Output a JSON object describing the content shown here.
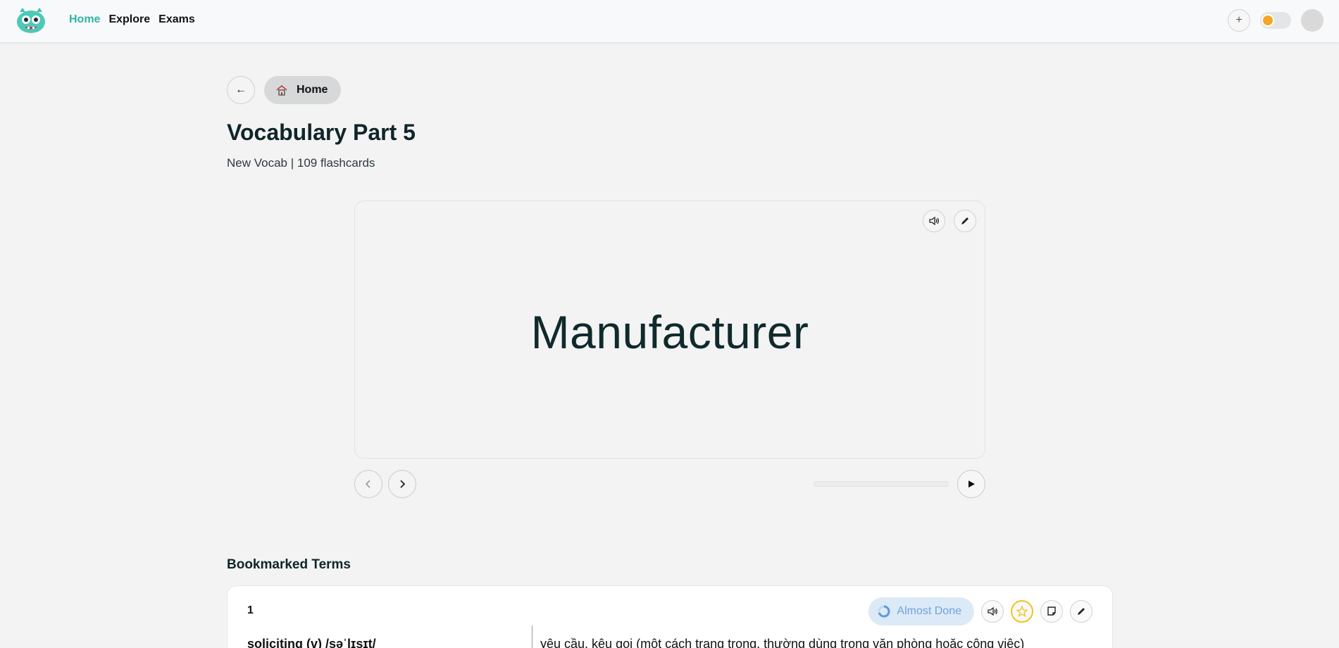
{
  "nav": {
    "links": [
      "Home",
      "Explore",
      "Exams"
    ],
    "add_symbol": "+"
  },
  "breadcrumb": {
    "back_symbol": "←",
    "home_label": "Home"
  },
  "page": {
    "title": "Vocabulary Part 5",
    "subtitle": "New Vocab | 109 flashcards"
  },
  "flashcard": {
    "term": "Manufacturer",
    "progress": 0
  },
  "bookmarked": {
    "title": "Bookmarked Terms",
    "items": [
      {
        "index": "1",
        "status": "Almost Done",
        "word": "soliciting (v) /səˈlɪsɪt/",
        "definition": "yêu cầu, kêu gọi (một cách trang trọng, thường dùng trong văn phòng hoặc công việc)"
      }
    ]
  },
  "colors": {
    "accent": "#2fb3a2",
    "status_bg": "#dce9f7",
    "status_text": "#6ea4dd",
    "star": "#f2c21b",
    "toggle_sun": "#f5a623"
  }
}
